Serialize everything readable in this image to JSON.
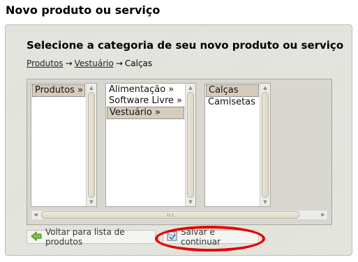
{
  "page": {
    "title": "Novo produto ou serviço"
  },
  "panel": {
    "heading": "Selecione a categoria de seu novo produto ou serviço",
    "breadcrumb": {
      "items": [
        "Produtos",
        "Vestuário"
      ],
      "separator": "→",
      "current": "Calças"
    },
    "lists": [
      {
        "items": [
          {
            "label": "Produtos »",
            "selected": true
          }
        ]
      },
      {
        "items": [
          {
            "label": "Alimentação »",
            "selected": false
          },
          {
            "label": "Software Livre »",
            "selected": false
          },
          {
            "label": "Vestuário »",
            "selected": true
          }
        ]
      },
      {
        "items": [
          {
            "label": "Calças",
            "selected": true
          },
          {
            "label": "Camisetas",
            "selected": false
          }
        ]
      }
    ]
  },
  "buttons": {
    "back_label": "Voltar para lista de produtos",
    "save_label": "Salvar e continuar"
  },
  "annotation": {
    "color": "#e60000"
  }
}
